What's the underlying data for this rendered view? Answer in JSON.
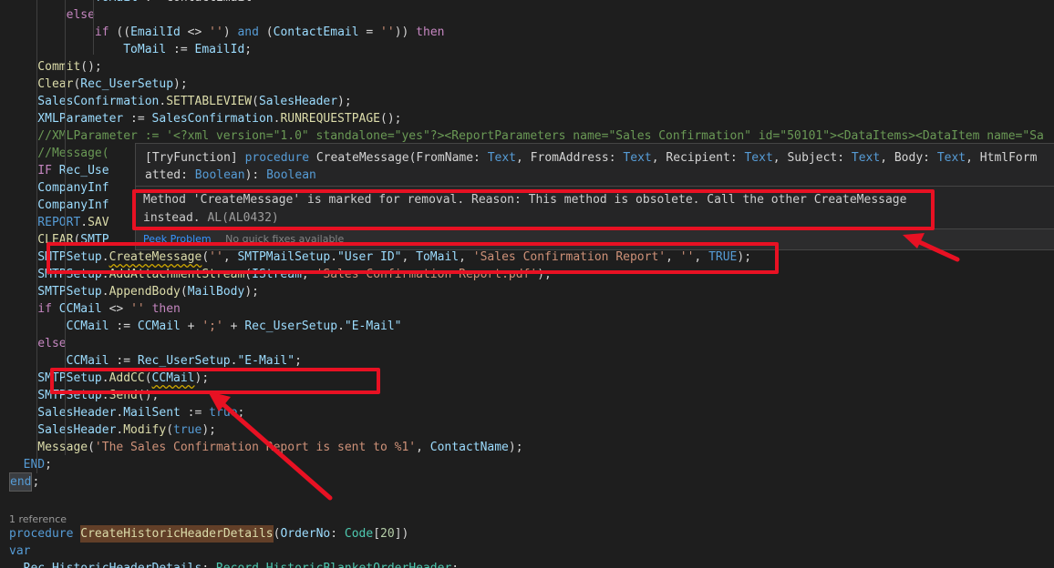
{
  "code_lines": [
    [
      {
        "c": "t-var",
        "t": "            ToMail"
      },
      {
        "c": "t-plain",
        "t": " := ContactEmail"
      }
    ],
    [
      {
        "c": "t-ctl",
        "t": "        else"
      }
    ],
    [
      {
        "c": "t-ctl",
        "t": "            if"
      },
      {
        "c": "t-plain",
        "t": " (("
      },
      {
        "c": "t-var",
        "t": "EmailId"
      },
      {
        "c": "t-plain",
        "t": " <> "
      },
      {
        "c": "t-str",
        "t": "''"
      },
      {
        "c": "t-plain",
        "t": ") "
      },
      {
        "c": "t-kw",
        "t": "and"
      },
      {
        "c": "t-plain",
        "t": " ("
      },
      {
        "c": "t-var",
        "t": "ContactEmail"
      },
      {
        "c": "t-plain",
        "t": " = "
      },
      {
        "c": "t-str",
        "t": "''"
      },
      {
        "c": "t-plain",
        "t": ")) "
      },
      {
        "c": "t-ctl",
        "t": "then"
      }
    ],
    [
      {
        "c": "t-var",
        "t": "                ToMail"
      },
      {
        "c": "t-plain",
        "t": " := "
      },
      {
        "c": "t-var",
        "t": "EmailId"
      },
      {
        "c": "t-plain",
        "t": ";"
      }
    ],
    [
      {
        "c": "t-fn",
        "t": "    Commit"
      },
      {
        "c": "t-plain",
        "t": "();"
      }
    ],
    [
      {
        "c": "t-fn",
        "t": "    Clear"
      },
      {
        "c": "t-plain",
        "t": "("
      },
      {
        "c": "t-var",
        "t": "Rec_UserSetup"
      },
      {
        "c": "t-plain",
        "t": ");"
      }
    ],
    [
      {
        "c": "t-var",
        "t": "    SalesConfirmation"
      },
      {
        "c": "t-plain",
        "t": "."
      },
      {
        "c": "t-fn",
        "t": "SETTABLEVIEW"
      },
      {
        "c": "t-plain",
        "t": "("
      },
      {
        "c": "t-var",
        "t": "SalesHeader"
      },
      {
        "c": "t-plain",
        "t": ");"
      }
    ],
    [
      {
        "c": "t-var",
        "t": "    XMLParameter"
      },
      {
        "c": "t-plain",
        "t": " := "
      },
      {
        "c": "t-var",
        "t": "SalesConfirmation"
      },
      {
        "c": "t-plain",
        "t": "."
      },
      {
        "c": "t-fn",
        "t": "RUNREQUESTPAGE"
      },
      {
        "c": "t-plain",
        "t": "();"
      }
    ],
    [
      {
        "c": "t-cmt",
        "t": "    //XMLParameter := '<?xml version=\"1.0\" standalone=\"yes\"?><ReportParameters name=\"Sales Confirmation\" id=\"50101\"><DataItems><DataItem name=\"Sa"
      }
    ],
    [
      {
        "c": "t-cmt",
        "t": "    //Message("
      }
    ],
    [
      {
        "c": "t-ctl",
        "t": "    IF"
      },
      {
        "c": "t-plain",
        "t": " "
      },
      {
        "c": "t-var",
        "t": "Rec_Use"
      }
    ],
    [
      {
        "c": "t-var",
        "t": "    CompanyInf"
      }
    ],
    [
      {
        "c": "t-var",
        "t": "    CompanyInf"
      }
    ],
    [
      {
        "c": "t-kw",
        "t": "    REPORT"
      },
      {
        "c": "t-plain",
        "t": "."
      },
      {
        "c": "t-fn",
        "t": "SAV"
      }
    ],
    [
      {
        "c": "t-fn",
        "t": "    CLEAR"
      },
      {
        "c": "t-plain",
        "t": "("
      },
      {
        "c": "t-var",
        "t": "SMTP"
      }
    ],
    [
      {
        "c": "t-var",
        "t": "    SMTPSetup"
      },
      {
        "c": "t-plain",
        "t": "."
      },
      {
        "c": "t-fn squig",
        "t": "CreateMessage"
      },
      {
        "c": "t-plain",
        "t": "("
      },
      {
        "c": "t-str",
        "t": "''"
      },
      {
        "c": "t-plain",
        "t": ", "
      },
      {
        "c": "t-var",
        "t": "SMTPMailSetup"
      },
      {
        "c": "t-plain",
        "t": "."
      },
      {
        "c": "t-var",
        "t": "\"User ID\""
      },
      {
        "c": "t-plain",
        "t": ", "
      },
      {
        "c": "t-var",
        "t": "ToMail"
      },
      {
        "c": "t-plain",
        "t": ", "
      },
      {
        "c": "t-str",
        "t": "'Sales Confirmation Report'"
      },
      {
        "c": "t-plain",
        "t": ", "
      },
      {
        "c": "t-str",
        "t": "''"
      },
      {
        "c": "t-plain",
        "t": ", "
      },
      {
        "c": "t-kw",
        "t": "TRUE"
      },
      {
        "c": "t-plain",
        "t": ");"
      }
    ],
    [
      {
        "c": "t-var",
        "t": "    SMTPSetup"
      },
      {
        "c": "t-plain",
        "t": "."
      },
      {
        "c": "t-fn",
        "t": "AddAttachmentStream"
      },
      {
        "c": "t-plain",
        "t": "("
      },
      {
        "c": "t-var",
        "t": "IStream"
      },
      {
        "c": "t-plain",
        "t": ", "
      },
      {
        "c": "t-str",
        "t": "'Sales Confirmation Report.pdf'"
      },
      {
        "c": "t-plain",
        "t": ");"
      }
    ],
    [
      {
        "c": "t-var",
        "t": "    SMTPSetup"
      },
      {
        "c": "t-plain",
        "t": "."
      },
      {
        "c": "t-fn",
        "t": "AppendBody"
      },
      {
        "c": "t-plain",
        "t": "("
      },
      {
        "c": "t-var",
        "t": "MailBody"
      },
      {
        "c": "t-plain",
        "t": ");"
      }
    ],
    [
      {
        "c": "t-ctl",
        "t": "    if"
      },
      {
        "c": "t-plain",
        "t": " "
      },
      {
        "c": "t-var",
        "t": "CCMail"
      },
      {
        "c": "t-plain",
        "t": " <> "
      },
      {
        "c": "t-str",
        "t": "''"
      },
      {
        "c": "t-plain",
        "t": " "
      },
      {
        "c": "t-ctl",
        "t": "then"
      }
    ],
    [
      {
        "c": "t-var",
        "t": "        CCMail"
      },
      {
        "c": "t-plain",
        "t": " := "
      },
      {
        "c": "t-var",
        "t": "CCMail"
      },
      {
        "c": "t-plain",
        "t": " + "
      },
      {
        "c": "t-str",
        "t": "';'"
      },
      {
        "c": "t-plain",
        "t": " + "
      },
      {
        "c": "t-var",
        "t": "Rec_UserSetup"
      },
      {
        "c": "t-plain",
        "t": "."
      },
      {
        "c": "t-var",
        "t": "\"E-Mail\""
      }
    ],
    [
      {
        "c": "t-ctl",
        "t": "    else"
      }
    ],
    [
      {
        "c": "t-var",
        "t": "        CCMail"
      },
      {
        "c": "t-plain",
        "t": " := "
      },
      {
        "c": "t-var",
        "t": "Rec_UserSetup"
      },
      {
        "c": "t-plain",
        "t": "."
      },
      {
        "c": "t-var",
        "t": "\"E-Mail\""
      },
      {
        "c": "t-plain",
        "t": ";"
      }
    ],
    [
      {
        "c": "t-var",
        "t": "    SMTPSetup"
      },
      {
        "c": "t-plain",
        "t": "."
      },
      {
        "c": "t-fn",
        "t": "AddCC"
      },
      {
        "c": "t-plain",
        "t": "("
      },
      {
        "c": "t-var squig",
        "t": "CCMail"
      },
      {
        "c": "t-plain",
        "t": ");"
      }
    ],
    [
      {
        "c": "t-var",
        "t": "    SMTPSetup"
      },
      {
        "c": "t-plain",
        "t": "."
      },
      {
        "c": "t-fn",
        "t": "Send"
      },
      {
        "c": "t-plain",
        "t": "();"
      }
    ],
    [
      {
        "c": "t-var",
        "t": "    SalesHeader"
      },
      {
        "c": "t-plain",
        "t": "."
      },
      {
        "c": "t-var",
        "t": "MailSent"
      },
      {
        "c": "t-plain",
        "t": " := "
      },
      {
        "c": "t-kw",
        "t": "true"
      },
      {
        "c": "t-plain",
        "t": ";"
      }
    ],
    [
      {
        "c": "t-var",
        "t": "    SalesHeader"
      },
      {
        "c": "t-plain",
        "t": "."
      },
      {
        "c": "t-fn",
        "t": "Modify"
      },
      {
        "c": "t-plain",
        "t": "("
      },
      {
        "c": "t-kw",
        "t": "true"
      },
      {
        "c": "t-plain",
        "t": ");"
      }
    ],
    [
      {
        "c": "t-fn",
        "t": "    Message"
      },
      {
        "c": "t-plain",
        "t": "("
      },
      {
        "c": "t-str",
        "t": "'The Sales Confirmation Report is sent to %1'"
      },
      {
        "c": "t-plain",
        "t": ", "
      },
      {
        "c": "t-var",
        "t": "ContactName"
      },
      {
        "c": "t-plain",
        "t": ");"
      }
    ],
    [
      {
        "c": "t-kw",
        "t": "  END"
      },
      {
        "c": "t-plain",
        "t": ";"
      }
    ],
    [
      {
        "c": "t-kw end-hl",
        "t": "end"
      },
      {
        "c": "t-plain",
        "t": ";"
      }
    ],
    [
      {
        "c": "t-plain",
        "t": ""
      }
    ],
    [
      {
        "c": "t-plain",
        "t": ""
      }
    ],
    [
      {
        "c": "t-kw",
        "t": "procedure"
      },
      {
        "c": "t-plain",
        "t": " "
      },
      {
        "c": "t-fn hl-word",
        "t": "CreateHistoricHeaderDetails"
      },
      {
        "c": "t-plain",
        "t": "("
      },
      {
        "c": "t-var",
        "t": "OrderNo"
      },
      {
        "c": "t-plain",
        "t": ": "
      },
      {
        "c": "t-type",
        "t": "Code"
      },
      {
        "c": "t-plain",
        "t": "["
      },
      {
        "c": "t-num",
        "t": "20"
      },
      {
        "c": "t-plain",
        "t": "])"
      }
    ],
    [
      {
        "c": "t-kw",
        "t": "var"
      }
    ],
    [
      {
        "c": "t-var",
        "t": "  Rec_HistoricHeaderDetails"
      },
      {
        "c": "t-plain",
        "t": ": "
      },
      {
        "c": "t-type",
        "t": "Record"
      },
      {
        "c": "t-plain",
        "t": " "
      },
      {
        "c": "t-type",
        "t": "HistoricBlanketOrderHeader"
      },
      {
        "c": "t-plain",
        "t": ";"
      }
    ]
  ],
  "codelens": "1 reference",
  "hover": {
    "signature": [
      {
        "c": "t-plain",
        "t": "[TryFunction] "
      },
      {
        "c": "t-kw",
        "t": "procedure"
      },
      {
        "c": "t-plain",
        "t": " CreateMessage(FromName: "
      },
      {
        "c": "t-kw",
        "t": "Text"
      },
      {
        "c": "t-plain",
        "t": ", FromAddress: "
      },
      {
        "c": "t-kw",
        "t": "Text"
      },
      {
        "c": "t-plain",
        "t": ", Recipient: "
      },
      {
        "c": "t-kw",
        "t": "Text"
      },
      {
        "c": "t-plain",
        "t": ", Subject: "
      },
      {
        "c": "t-kw",
        "t": "Text"
      },
      {
        "c": "t-plain",
        "t": ", Body: "
      },
      {
        "c": "t-kw",
        "t": "Text"
      },
      {
        "c": "t-plain",
        "t": ", HtmlFormatted: "
      },
      {
        "c": "t-kw",
        "t": "Boolean"
      },
      {
        "c": "t-plain",
        "t": "): "
      },
      {
        "c": "t-kw",
        "t": "Boolean"
      }
    ],
    "message": "Method 'CreateMessage' is marked for removal. Reason: This method is obsolete. Call the other CreateMessage instead.",
    "code": "AL(AL0432)",
    "peek_label": "Peek Problem",
    "quickfix_label": "No quick fixes available"
  },
  "colors": {
    "annotation": "#e81123"
  }
}
